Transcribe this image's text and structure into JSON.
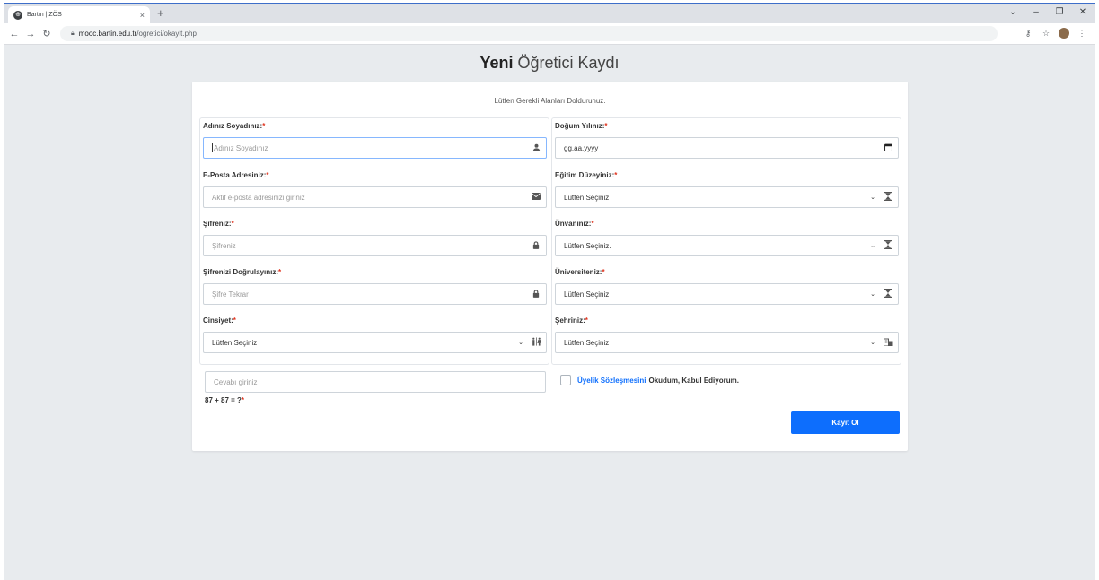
{
  "browser": {
    "tab_title": "Bartın | ZÖS",
    "tab_close": "×",
    "new_tab": "+",
    "url_host": "mooc.bartin.edu.tr",
    "url_path": "/ogretici/okayit.php",
    "controls": {
      "chevron": "⌄",
      "minimize": "–",
      "restore": "❐",
      "close": "✕"
    }
  },
  "page": {
    "title_bold": "Yeni",
    "title_rest": " Öğretici Kaydı",
    "subtitle": "Lütfen Gerekli Alanları Doldurunuz."
  },
  "left_fields": [
    {
      "label": "Adınız Soyadınız:",
      "placeholder": "Adınız Soyadınız",
      "icon": "user-icon"
    },
    {
      "label": "E-Posta Adresiniz:",
      "placeholder": "Aktif e-posta adresinizi giriniz",
      "icon": "envelope-icon"
    },
    {
      "label": "Şifreniz:",
      "placeholder": "Şifreniz",
      "icon": "lock-icon"
    },
    {
      "label": "Şifrenizi Doğrulayınız:",
      "placeholder": "Şifre Tekrar",
      "icon": "lock-icon"
    },
    {
      "label": "Cinsiyet:",
      "value": "Lütfen Seçiniz",
      "icon": "gender-icon"
    }
  ],
  "right_fields": [
    {
      "label": "Doğum Yılınız:",
      "value": "gg.aa.yyyy",
      "icon": "calendar-icon"
    },
    {
      "label": "Eğitim Düzeyiniz:",
      "value": "Lütfen Seçiniz",
      "icon": "hourglass-icon"
    },
    {
      "label": "Ünvanınız:",
      "value": "Lütfen Seçiniz.",
      "icon": "hourglass-icon"
    },
    {
      "label": "Üniversiteniz:",
      "value": "Lütfen Seçiniz",
      "icon": "hourglass-icon"
    },
    {
      "label": "Şehriniz:",
      "value": "Lütfen Seçiniz",
      "icon": "city-icon"
    }
  ],
  "required_mark": "*",
  "captcha": {
    "placeholder": "Cevabı giriniz",
    "question": "87 + 87 = ?"
  },
  "agreement": {
    "link_text": "Üyelik Sözleşmesini",
    "text": "Okudum, Kabul Ediyorum."
  },
  "submit_label": "Kayıt Ol",
  "colors": {
    "primary": "#0d6efd",
    "required": "#e0341f"
  }
}
